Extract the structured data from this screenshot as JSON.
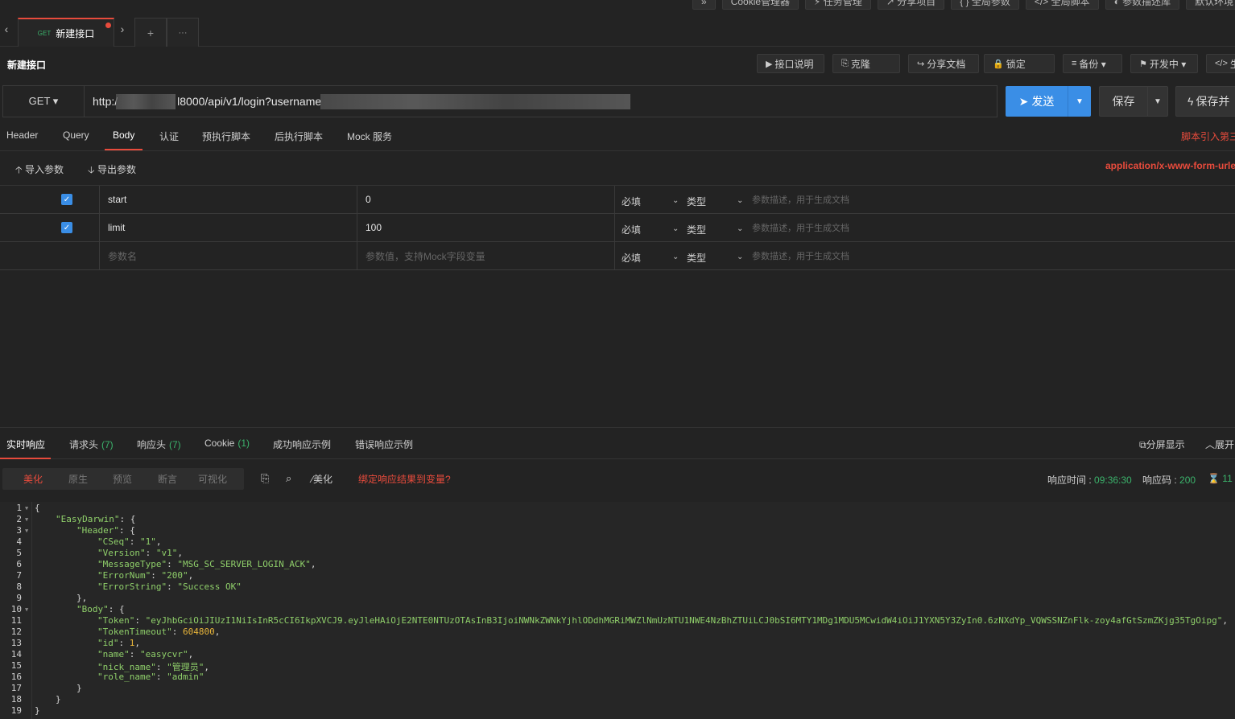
{
  "top_toolbar": [
    "»",
    "Cookie管理器",
    "⚡ 任务管理",
    "↗ 分享项目",
    "{ } 全局参数",
    "</> 全局脚本",
    "◐ 参数描述库",
    "默认环境"
  ],
  "tabs": {
    "method": "GET",
    "title": "新建接口",
    "add": "+",
    "more": "···"
  },
  "header": {
    "title": "新建接口",
    "buttons": [
      {
        "icon": "▶",
        "label": "接口说明"
      },
      {
        "icon": "⎘",
        "label": "克隆"
      },
      {
        "icon": "↪",
        "label": "分享文档"
      },
      {
        "icon": "🔒",
        "label": "锁定"
      },
      {
        "icon": "≡",
        "label": "备份 ▾"
      },
      {
        "icon": "⚑",
        "label": "开发中 ▾"
      },
      {
        "icon": "</>",
        "label": "生"
      }
    ]
  },
  "request": {
    "method": "GET ▾",
    "url_prefix": "http:/",
    "url_mid": "l8000/api/v1/login?username",
    "send": "发送",
    "save": "保存",
    "save_run": "保存并"
  },
  "request_tabs": [
    "Header",
    "Query",
    "Body",
    "认证",
    "预执行脚本",
    "后执行脚本",
    "Mock 服务"
  ],
  "script_note": "脚本引入第三",
  "io": {
    "import": "导入参数",
    "export": "导出参数"
  },
  "content_type": "application/x-www-form-urle",
  "params": [
    {
      "checked": true,
      "name": "start",
      "value": "0",
      "required": "必填",
      "type": "类型",
      "desc_placeholder": "参数描述，用于生成文档"
    },
    {
      "checked": true,
      "name": "limit",
      "value": "100",
      "required": "必填",
      "type": "类型",
      "desc_placeholder": "参数描述，用于生成文档"
    }
  ],
  "new_param": {
    "name_placeholder": "参数名",
    "value_placeholder": "参数值，支持Mock字段变量",
    "required": "必填",
    "type": "类型",
    "desc_placeholder": "参数描述，用于生成文档"
  },
  "response_tabs": [
    {
      "label": "实时响应",
      "count": ""
    },
    {
      "label": "请求头",
      "count": "(7)"
    },
    {
      "label": "响应头",
      "count": "(7)"
    },
    {
      "label": "Cookie",
      "count": "(1)"
    },
    {
      "label": "成功响应示例",
      "count": ""
    },
    {
      "label": "错误响应示例",
      "count": ""
    }
  ],
  "response_right": {
    "split": "分屏显示",
    "expand": "展开"
  },
  "view_modes": [
    "美化",
    "原生",
    "预览",
    "断言",
    "可视化"
  ],
  "beautify": "美化",
  "bind_var": "绑定响应结果到变量?",
  "meta": {
    "time_label": "响应时间 : ",
    "time": "09:36:30",
    "code_label": "响应码 : ",
    "code": "200",
    "size": "11"
  },
  "code_lines": [
    {
      "n": "1",
      "fold": true,
      "indent": 0,
      "parts": [
        [
          "p",
          "{"
        ]
      ]
    },
    {
      "n": "2",
      "fold": true,
      "indent": 1,
      "parts": [
        [
          "k",
          "\"EasyDarwin\""
        ],
        [
          "p",
          ": {"
        ]
      ]
    },
    {
      "n": "3",
      "fold": true,
      "indent": 2,
      "parts": [
        [
          "k",
          "\"Header\""
        ],
        [
          "p",
          ": {"
        ]
      ]
    },
    {
      "n": "4",
      "fold": false,
      "indent": 3,
      "parts": [
        [
          "k",
          "\"CSeq\""
        ],
        [
          "p",
          ": "
        ],
        [
          "s",
          "\"1\""
        ],
        [
          "p",
          ","
        ]
      ]
    },
    {
      "n": "5",
      "fold": false,
      "indent": 3,
      "parts": [
        [
          "k",
          "\"Version\""
        ],
        [
          "p",
          ": "
        ],
        [
          "s",
          "\"v1\""
        ],
        [
          "p",
          ","
        ]
      ]
    },
    {
      "n": "6",
      "fold": false,
      "indent": 3,
      "parts": [
        [
          "k",
          "\"MessageType\""
        ],
        [
          "p",
          ": "
        ],
        [
          "s",
          "\"MSG_SC_SERVER_LOGIN_ACK\""
        ],
        [
          "p",
          ","
        ]
      ]
    },
    {
      "n": "7",
      "fold": false,
      "indent": 3,
      "parts": [
        [
          "k",
          "\"ErrorNum\""
        ],
        [
          "p",
          ": "
        ],
        [
          "s",
          "\"200\""
        ],
        [
          "p",
          ","
        ]
      ]
    },
    {
      "n": "8",
      "fold": false,
      "indent": 3,
      "parts": [
        [
          "k",
          "\"ErrorString\""
        ],
        [
          "p",
          ": "
        ],
        [
          "s",
          "\"Success OK\""
        ]
      ]
    },
    {
      "n": "9",
      "fold": false,
      "indent": 2,
      "parts": [
        [
          "p",
          "},"
        ]
      ]
    },
    {
      "n": "10",
      "fold": true,
      "indent": 2,
      "parts": [
        [
          "k",
          "\"Body\""
        ],
        [
          "p",
          ": {"
        ]
      ]
    },
    {
      "n": "11",
      "fold": false,
      "indent": 3,
      "parts": [
        [
          "k",
          "\"Token\""
        ],
        [
          "p",
          ": "
        ],
        [
          "s",
          "\"eyJhbGciOiJIUzI1NiIsInR5cCI6IkpXVCJ9.eyJleHAiOjE2NTE0NTUzOTAsInB3IjoiNWNkZWNkYjhlODdhMGRiMWZlNmUzNTU1NWE4NzBhZTUiLCJ0bSI6MTY1MDg1MDU5MCwidW4iOiJ1YXN5Y3ZyIn0.6zNXdYp_VQWSSNZnFlk-zoy4afGtSzmZKjg35TgOipg\""
        ],
        [
          "p",
          ","
        ]
      ]
    },
    {
      "n": "12",
      "fold": false,
      "indent": 3,
      "parts": [
        [
          "k",
          "\"TokenTimeout\""
        ],
        [
          "p",
          ": "
        ],
        [
          "n",
          "604800"
        ],
        [
          "p",
          ","
        ]
      ]
    },
    {
      "n": "13",
      "fold": false,
      "indent": 3,
      "parts": [
        [
          "k",
          "\"id\""
        ],
        [
          "p",
          ": "
        ],
        [
          "n",
          "1"
        ],
        [
          "p",
          ","
        ]
      ]
    },
    {
      "n": "14",
      "fold": false,
      "indent": 3,
      "parts": [
        [
          "k",
          "\"name\""
        ],
        [
          "p",
          ": "
        ],
        [
          "s",
          "\"easycvr\""
        ],
        [
          "p",
          ","
        ]
      ]
    },
    {
      "n": "15",
      "fold": false,
      "indent": 3,
      "parts": [
        [
          "k",
          "\"nick_name\""
        ],
        [
          "p",
          ": "
        ],
        [
          "s",
          "\"管理员\""
        ],
        [
          "p",
          ","
        ]
      ]
    },
    {
      "n": "16",
      "fold": false,
      "indent": 3,
      "parts": [
        [
          "k",
          "\"role_name\""
        ],
        [
          "p",
          ": "
        ],
        [
          "s",
          "\"admin\""
        ]
      ]
    },
    {
      "n": "17",
      "fold": false,
      "indent": 2,
      "parts": [
        [
          "p",
          "}"
        ]
      ]
    },
    {
      "n": "18",
      "fold": false,
      "indent": 1,
      "parts": [
        [
          "p",
          "}"
        ]
      ]
    },
    {
      "n": "19",
      "fold": false,
      "indent": 0,
      "parts": [
        [
          "p",
          "}"
        ]
      ]
    }
  ]
}
